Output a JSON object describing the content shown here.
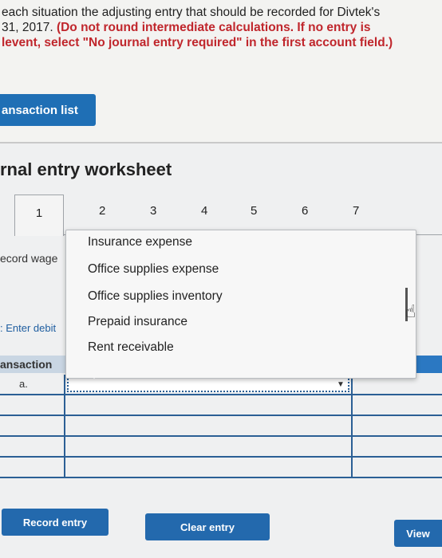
{
  "instructions": {
    "line1": "each situation the adjusting entry that should be recorded for Divtek's",
    "line2_plain": "31, 2017. ",
    "line2_red": "(Do not round intermediate calculations. If no entry is",
    "line3_red": "levent, select \"No journal entry required\" in the first account field.)"
  },
  "transaction_list_button": "ansaction list",
  "worksheet_title": "rnal entry worksheet",
  "tabs": [
    "1",
    "2",
    "3",
    "4",
    "5",
    "6",
    "7"
  ],
  "side": {
    "record_label": "ecord wage",
    "enter_label": ": Enter debit",
    "transaction_header": "ansaction"
  },
  "grid": {
    "rows": [
      "a.",
      "",
      "",
      "",
      ""
    ]
  },
  "dropdown": {
    "options": [
      "Insurance expense",
      "Office supplies expense",
      "Office supplies inventory",
      "Prepaid insurance",
      "Rent receivable"
    ]
  },
  "buttons": {
    "record_entry": "Record entry",
    "clear_entry": "Clear entry",
    "view": "View"
  }
}
